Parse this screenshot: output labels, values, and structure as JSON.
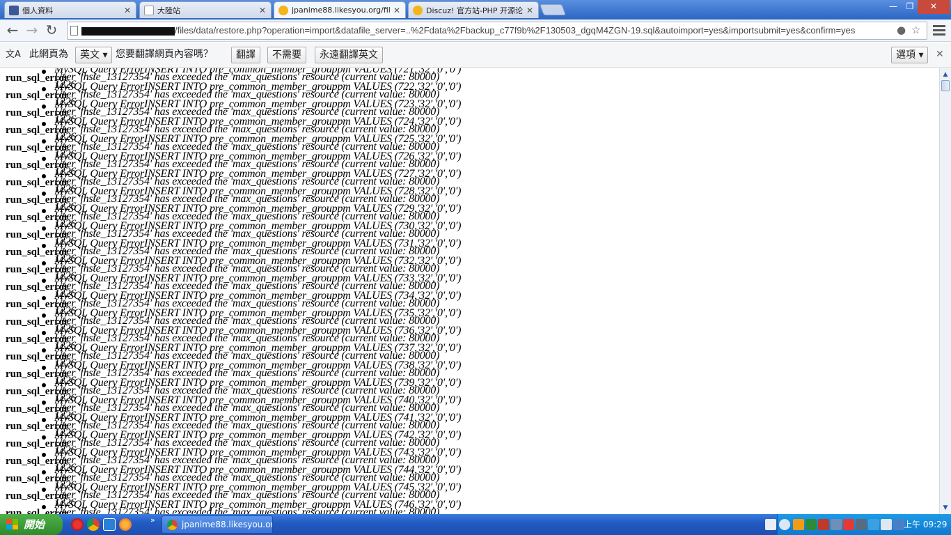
{
  "tabs": [
    {
      "title": "個人資料",
      "active": false
    },
    {
      "title": "大陸站",
      "active": false
    },
    {
      "title": "jpanime88.likesyou.org/files/",
      "active": true
    },
    {
      "title": "Discuz! 官方站-PHP 开源论",
      "active": false
    }
  ],
  "window_controls": {
    "minimize": "—",
    "maximize": "❐",
    "close": "✕"
  },
  "address": {
    "url_visible": "/files/data/restore.php?operation=import&datafile_server=..%2Fdata%2Fbackup_c77f9b%2F130503_dgqM4ZGN-19.sql&autoimport=yes&importsubmit=yes&confirm=yes"
  },
  "translate_bar": {
    "prefix": "此網頁為",
    "language": "英文",
    "question": "您要翻譯網頁內容嗎？",
    "translate_button": "翻譯",
    "no_button": "不需要",
    "always_button": "永遠翻譯英文",
    "options_button": "選項"
  },
  "content": {
    "label": "run_sql_error",
    "message_line1_prefix": "MySQL Query ErrorINSERT INTO pre_common_member_grouppm VALUES (",
    "message_line1_suffix": ",'32','0','0')",
    "message_line2": "User 'fhste_13127354' has exceeded the 'max_questions' resource (current value: 80000)",
    "message_line3": "1226",
    "ids": [
      721,
      722,
      723,
      724,
      725,
      726,
      727,
      728,
      729,
      730,
      731,
      732,
      733,
      734,
      735,
      736,
      737,
      738,
      739,
      740,
      741,
      742,
      743,
      744,
      745,
      746
    ]
  },
  "taskbar": {
    "start_label": "開始",
    "task_item": "jpanime88.likesyou.or...",
    "clock": "上午 09:29"
  }
}
